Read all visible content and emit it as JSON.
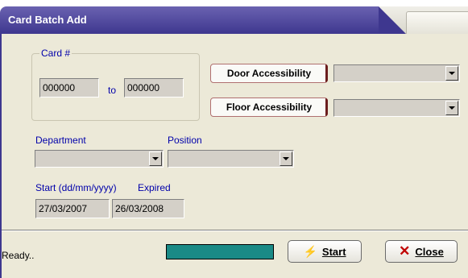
{
  "window": {
    "title": "Card Batch Add"
  },
  "card_range": {
    "legend": "Card #",
    "from_value": "000000",
    "to_label": "to",
    "to_value": "000000"
  },
  "access": {
    "door_button": "Door Accessibility",
    "floor_button": "Floor Accessibility",
    "door_value": "",
    "floor_value": ""
  },
  "department": {
    "label": "Department",
    "value": ""
  },
  "position": {
    "label": "Position",
    "value": ""
  },
  "dates": {
    "start_label": "Start (dd/mm/yyyy)",
    "expired_label": "Expired",
    "start_value": "27/03/2007",
    "expired_value": "26/03/2008"
  },
  "status": {
    "text": "Ready..",
    "progress_color": "#1a8a86"
  },
  "actions": {
    "start": "Start",
    "close": "Close"
  },
  "colors": {
    "title_bar": "#3e378f",
    "label_text": "#0000aa",
    "dialog_bg": "#ece9d8"
  }
}
